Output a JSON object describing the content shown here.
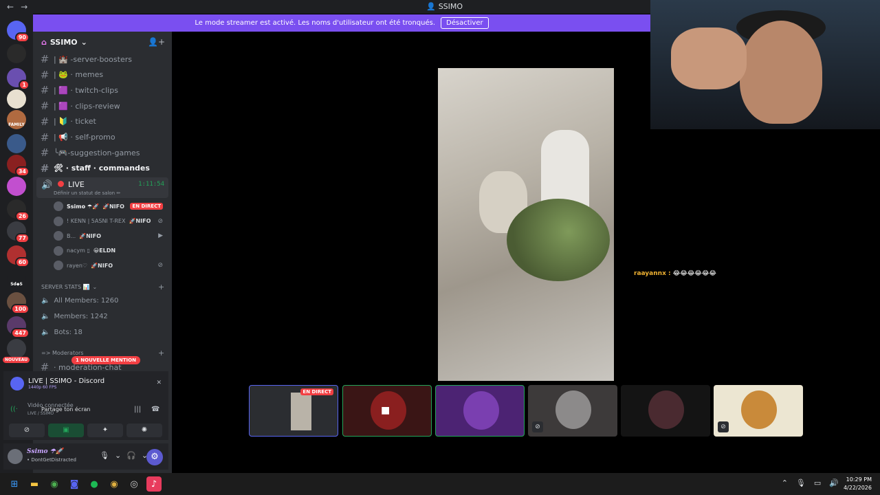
{
  "window": {
    "title": "SSIMO",
    "back": "←",
    "forward": "→"
  },
  "banner": {
    "text": "Le mode streamer est activé. Les noms d'utilisateur ont été tronqués.",
    "button": "Désactiver"
  },
  "guilds": [
    {
      "badge": "90"
    },
    {
      "badge": ""
    },
    {
      "badge": "1"
    },
    {
      "badge": ""
    },
    {
      "badge": "",
      "label": "FAMILY"
    },
    {
      "badge": ""
    },
    {
      "badge": "34"
    },
    {
      "badge": ""
    },
    {
      "badge": "26"
    },
    {
      "badge": "77"
    },
    {
      "badge": "60"
    },
    {
      "badge": "",
      "label": "Sd◆S"
    },
    {
      "badge": "100"
    },
    {
      "badge": "447"
    },
    {
      "badge": ""
    }
  ],
  "nouveau": "NOUVEAU",
  "server": {
    "name": "SSIMO",
    "chevron": "⌄"
  },
  "channels": [
    "| 🏰 -server-boosters",
    "| 🐸 · memes",
    "| 🟪 · twitch-clips",
    "| 🟪 · clips-review",
    "| 🔰 · ticket",
    "| 📢 · self-promo",
    "╰🎮-suggestion-games",
    "🛠 · staff · commandes"
  ],
  "voice": {
    "name": "LIVE",
    "status": "Définir un statut de salon ✏",
    "time": "1:11:54"
  },
  "voice_users": [
    {
      "name": "Ssimo ☂🚀",
      "tag": "🚀NIFO",
      "live": "EN DIRECT"
    },
    {
      "name": "! KENN | 5ASNI T-REX",
      "tag": "🚀NIFO",
      "icon": "⊘"
    },
    {
      "name": "B...",
      "tag": "🚀NIFO",
      "icon": "▶"
    },
    {
      "name": "nacym ▯",
      "tag": "😀ELDN",
      "icon": ""
    },
    {
      "name": "rayen♡",
      "tag": "🚀NIFO",
      "icon": "⊘"
    }
  ],
  "stats": {
    "category": "SERVER STATS 📊",
    "all": "All Members: 1260",
    "members": "Members: 1242",
    "bots": "Bots: 18"
  },
  "moderators": {
    "category": "=> Moderators",
    "channel": "· moderation-chat"
  },
  "mention": "1 NOUVELLE MENTION",
  "stream_panel": {
    "title": "LIVE | SSIMO - Discord",
    "quality": "1440p 60 FPS",
    "voice": "Vidéo connectée",
    "voice_sub": "LIVE / SSIMO",
    "share": "Partage ton écran"
  },
  "me": {
    "name": "Ssimo ☂🚀",
    "status": "• DontGetDistracted"
  },
  "chat": {
    "user": "raayannx :",
    "message": "😂😂😂😂😂😂"
  },
  "tile_live": "EN DIRECT",
  "clock": {
    "time": "10:29 PM",
    "date": "4/22/2026"
  }
}
